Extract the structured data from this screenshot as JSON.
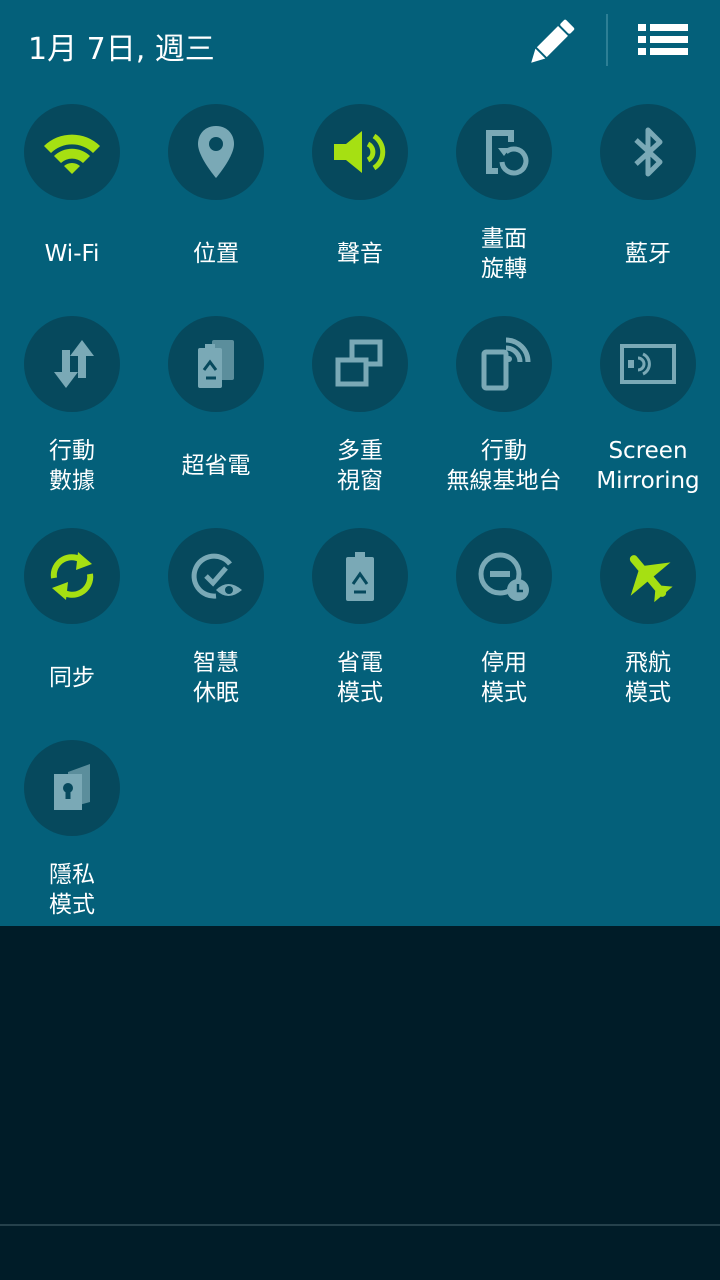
{
  "header": {
    "date": "1月 7日, 週三",
    "edit_icon": "pencil-icon",
    "list_icon": "list-icon"
  },
  "colors": {
    "panel_bg": "#04607a",
    "circle_bg": "#06495d",
    "active_icon": "#a6e012",
    "inactive_icon": "#7aa9b6",
    "shade_bg": "#001c28"
  },
  "toggles": [
    {
      "label": "Wi-Fi",
      "icon": "wifi-icon",
      "active": true
    },
    {
      "label": "位置",
      "icon": "location-icon",
      "active": false
    },
    {
      "label": "聲音",
      "icon": "sound-icon",
      "active": true
    },
    {
      "label": "畫面\n旋轉",
      "icon": "screen-rotation-icon",
      "active": false
    },
    {
      "label": "藍牙",
      "icon": "bluetooth-icon",
      "active": false
    },
    {
      "label": "行動\n數據",
      "icon": "mobile-data-icon",
      "active": false
    },
    {
      "label": "超省電",
      "icon": "ultra-power-saving-icon",
      "active": false
    },
    {
      "label": "多重\n視窗",
      "icon": "multi-window-icon",
      "active": false
    },
    {
      "label": "行動\n無線基地台",
      "icon": "mobile-hotspot-icon",
      "active": false
    },
    {
      "label": "Screen\nMirroring",
      "icon": "screen-mirroring-icon",
      "active": false
    },
    {
      "label": "同步",
      "icon": "sync-icon",
      "active": true
    },
    {
      "label": "智慧\n休眠",
      "icon": "smart-stay-icon",
      "active": false
    },
    {
      "label": "省電\n模式",
      "icon": "power-saving-icon",
      "active": false
    },
    {
      "label": "停用\n模式",
      "icon": "blocking-mode-icon",
      "active": false
    },
    {
      "label": "飛航\n模式",
      "icon": "airplane-icon",
      "active": true
    },
    {
      "label": "隱私\n模式",
      "icon": "private-mode-icon",
      "active": false
    }
  ]
}
